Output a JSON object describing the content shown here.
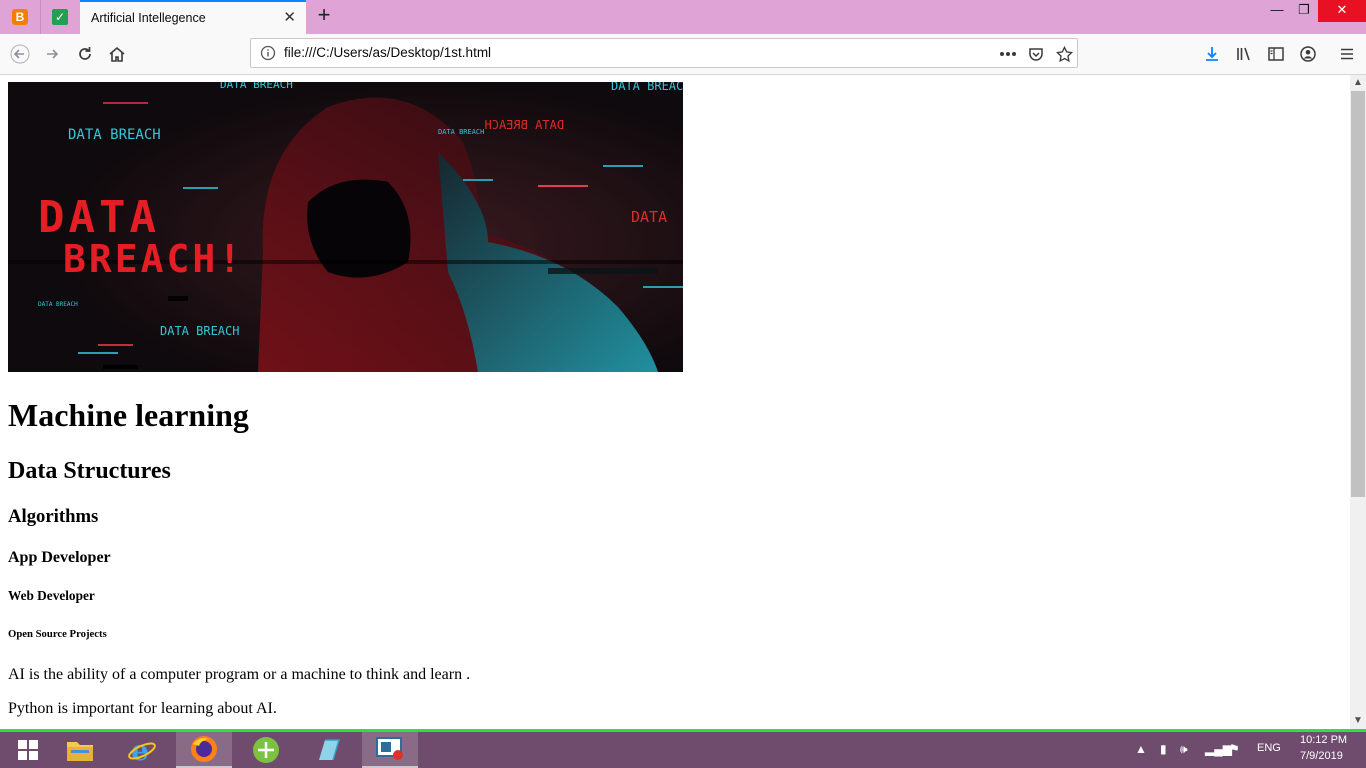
{
  "browser": {
    "tab_title": "Artificial Intellegence",
    "url": "file:///C:/Users/as/Desktop/1st.html",
    "accent": "#0a84ff",
    "titlebar_color": "#dfa3d5"
  },
  "hero_image": {
    "texts": [
      "DATA BREACH",
      "DATA BREACH",
      "DATA BREACH",
      "DATA BREACH",
      "DATA",
      "DATA BREACH",
      "DATA",
      "BREACH!",
      "DATA BREACH"
    ],
    "mirrored_text": "DATA BREACH"
  },
  "page": {
    "h1": "Machine learning",
    "h2": "Data Structures",
    "h3": "Algorithms",
    "h4": "App Developer",
    "h5": "Web Developer",
    "h6": "Open Source Projects",
    "p1": "AI is the ability of a computer program or a machine to think and learn .",
    "p2": "Python is important for learning about AI."
  },
  "taskbar": {
    "language": "ENG",
    "time": "10:12 PM",
    "date": "7/9/2019",
    "color": "#6f4b6e"
  }
}
